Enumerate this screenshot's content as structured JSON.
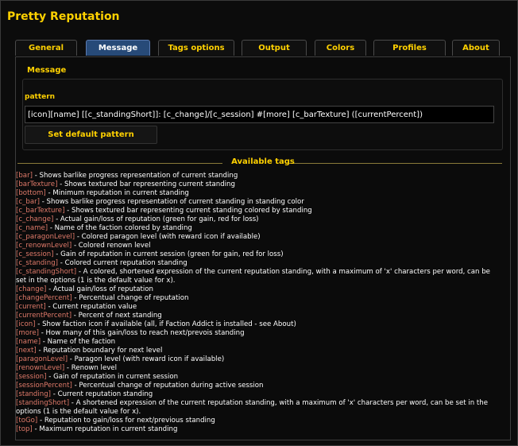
{
  "window": {
    "title": "Pretty Reputation"
  },
  "tabs": [
    {
      "label": "General",
      "active": false
    },
    {
      "label": "Message",
      "active": true
    },
    {
      "label": "Tags options",
      "active": false
    },
    {
      "label": "Output",
      "active": false
    },
    {
      "label": "Colors",
      "active": false
    },
    {
      "label": "Profiles",
      "active": false
    },
    {
      "label": "About",
      "active": false
    }
  ],
  "message": {
    "section_label": "Message",
    "pattern_label": "pattern",
    "pattern_value": "[icon][name] [[c_standingShort]]: [c_change]/[c_session] #[more] [c_barTexture]  ([currentPercent])",
    "default_button": "Set default pattern"
  },
  "tags": {
    "heading": "Available tags",
    "items": [
      {
        "name": "[bar]",
        "desc": " - Shows barlike progress representation of current standing"
      },
      {
        "name": "[barTexture]",
        "desc": " - Shows textured bar representing current standing"
      },
      {
        "name": "[bottom]",
        "desc": " - Minimum reputation in current standing"
      },
      {
        "name": "[c_bar]",
        "desc": " - Shows barlike progress representation of current standing in standing color"
      },
      {
        "name": "[c_barTexture]",
        "desc": " - Shows textured bar representing current standing colored by standing"
      },
      {
        "name": "[c_change]",
        "desc": " - Actual gain/loss of reputation (green for gain, red for loss)"
      },
      {
        "name": "[c_name]",
        "desc": " - Name of the faction colored by standing"
      },
      {
        "name": "[c_paragonLevel]",
        "desc": " - Colored paragon level (with reward icon if available)"
      },
      {
        "name": "[c_renownLevel]",
        "desc": " - Colored renown level"
      },
      {
        "name": "[c_session]",
        "desc": " - Gain of reputation in current session (green for gain, red for loss)"
      },
      {
        "name": "[c_standing]",
        "desc": " - Colored current reputation standing"
      },
      {
        "name": "[c_standingShort]",
        "desc": " - A colored, shortened expression of the current reputation standing, with a maximum of 'x' characters per word, can be set in the options (1 is the default value for x)."
      },
      {
        "name": "[change]",
        "desc": " - Actual gain/loss of reputation"
      },
      {
        "name": "[changePercent]",
        "desc": " - Percentual change of reputation"
      },
      {
        "name": "[current]",
        "desc": " - Current reputation value"
      },
      {
        "name": "[currentPercent]",
        "desc": " - Percent of next standing"
      },
      {
        "name": "[icon]",
        "desc": " - Show faction icon if available (all, if Faction Addict is installed - see About)"
      },
      {
        "name": "[more]",
        "desc": " - How many of this gain/loss to reach next/prevois standing"
      },
      {
        "name": "[name]",
        "desc": " - Name of the faction"
      },
      {
        "name": "[next]",
        "desc": " - Reputation boundary for next level"
      },
      {
        "name": "[paragonLevel]",
        "desc": " - Paragon level (with reward icon if available)"
      },
      {
        "name": "[renownLevel]",
        "desc": " - Renown level"
      },
      {
        "name": "[session]",
        "desc": " - Gain of reputation in current session"
      },
      {
        "name": "[sessionPercent]",
        "desc": " - Percentual change of reputation during active session"
      },
      {
        "name": "[standing]",
        "desc": " - Current reputation standing"
      },
      {
        "name": "[standingShort]",
        "desc": " - A shortened expression of the current reputation standing, with a maximum of 'x' characters per word, can be set in the options (1 is the default value for x)."
      },
      {
        "name": "[toGo]",
        "desc": " - Reputation to gain/loss for next/previous standing"
      },
      {
        "name": "[top]",
        "desc": " - Maximum reputation in current standing"
      }
    ]
  }
}
